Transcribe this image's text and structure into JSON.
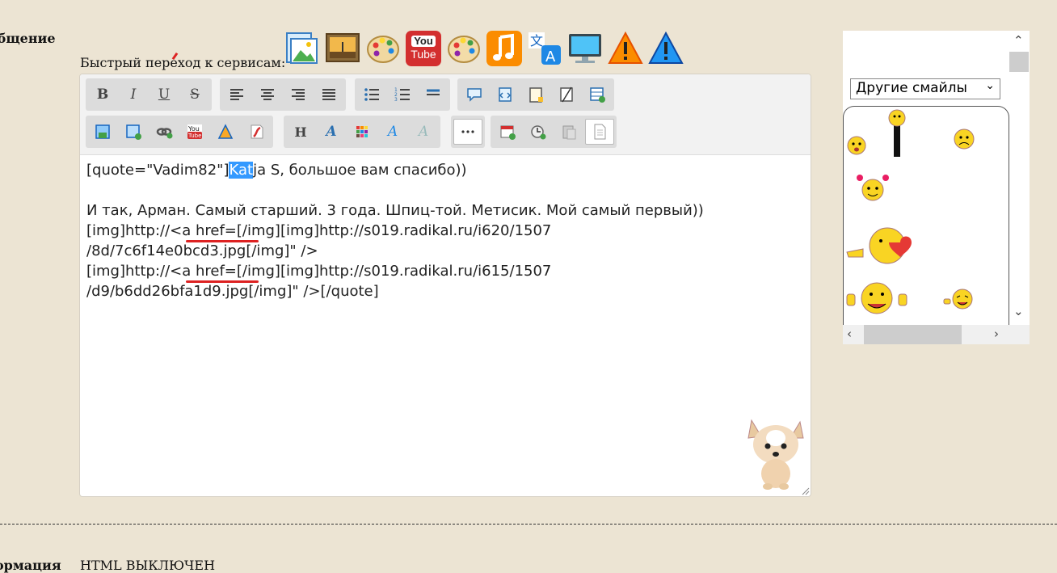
{
  "form": {
    "message_label": "общение",
    "quick_services_label": "Быстрый переход к сервисам:",
    "info_label": "ормация",
    "html_status": "HTML ВЫКЛЮЧЕН"
  },
  "services": [
    {
      "name": "image-upload-icon"
    },
    {
      "name": "photo-frame-icon"
    },
    {
      "name": "palette-icon"
    },
    {
      "name": "youtube-icon",
      "label": "You Tube"
    },
    {
      "name": "palette-alt-icon"
    },
    {
      "name": "music-note-icon"
    },
    {
      "name": "translate-icon"
    },
    {
      "name": "monitor-icon"
    },
    {
      "name": "warning-orange-icon"
    },
    {
      "name": "warning-blue-icon"
    }
  ],
  "toolbar": {
    "bold": "B",
    "italic": "I",
    "underline": "U",
    "strike": "S",
    "heading": "H",
    "font_color": "A",
    "font_style": "A",
    "font_clear": "A",
    "youtube": "You Tube"
  },
  "editor": {
    "line1_pre": "[quote=\"Vadim82\"]",
    "line1_sel": "Kat",
    "line1_post": "ja S, большое вам спасибо))",
    "line3": "И так, Арман. Самый старший. 3 года. Шпиц-той. Метисик. Мой самый первый))",
    "line4": "[img]http://<a href=[/img][img]http://s019.radikal.ru/i620/1507",
    "line5": "/8d/7c6f14e0bcd3.jpg[/img]\" />",
    "line6": "[img]http://<a href=[/img][img]http://s019.radikal.ru/i615/1507",
    "line7": "/d9/b6dd26bfa1d9.jpg[/img]\" />[/quote]"
  },
  "smileys": {
    "select_value": "Другие смайлы"
  },
  "colors": {
    "page_bg": "#ece4d3",
    "selection": "#3399ff",
    "spell_error": "#dd2222"
  }
}
